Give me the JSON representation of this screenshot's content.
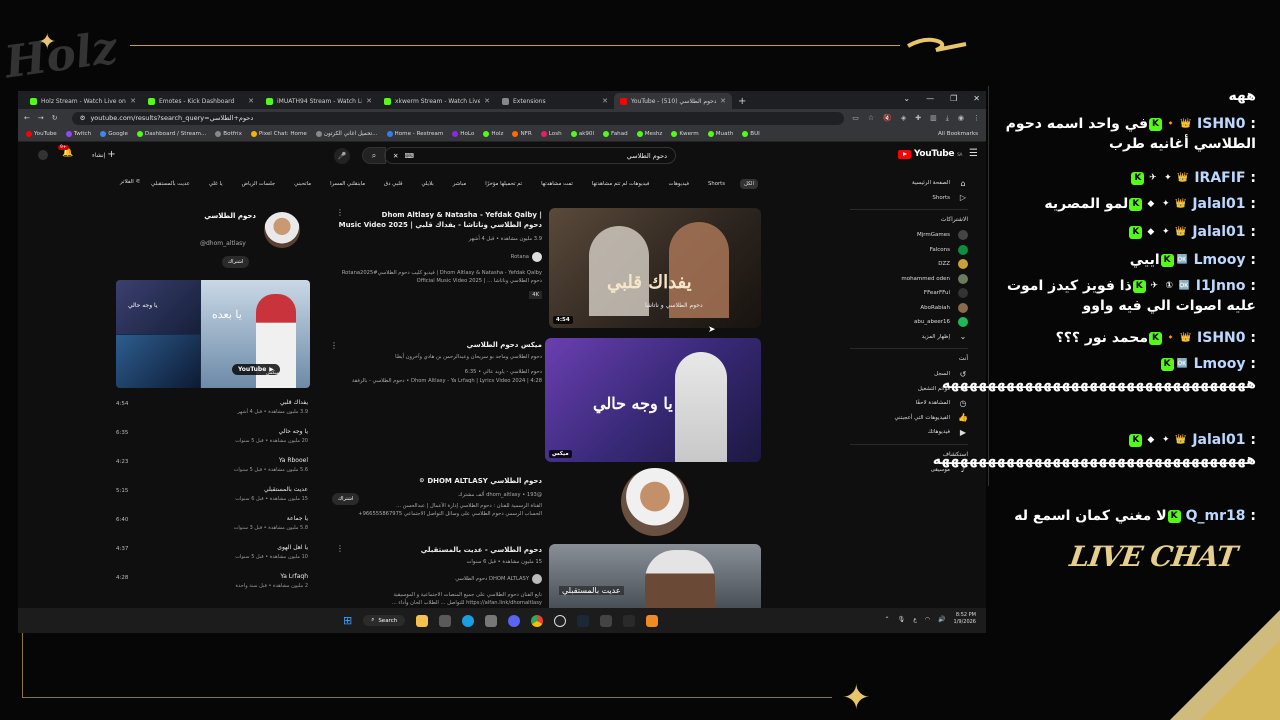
{
  "overlay": {
    "logo_text": "Holz",
    "live_chat_label": "LIVE CHAT"
  },
  "browser": {
    "tabs": [
      {
        "label": "Holz Stream - Watch Live on Ki",
        "color": "#53fc18",
        "active": false
      },
      {
        "label": "Emotes - Kick Dashboard",
        "color": "#53fc18",
        "active": false
      },
      {
        "label": "iMUATH94 Stream - Watch Live",
        "color": "#53fc18",
        "active": false
      },
      {
        "label": "xkwerm Stream - Watch Live on",
        "color": "#53fc18",
        "active": false
      },
      {
        "label": "Extensions",
        "color": "#888888",
        "active": false
      },
      {
        "label": "YouTube - دحوم الطلاسي (510)",
        "color": "#ff0000",
        "active": true
      }
    ],
    "url": "youtube.com/results?search_query=دحوم+الطلاسي",
    "all_bookmarks": "All Bookmarks",
    "bookmarks": [
      {
        "label": "YouTube",
        "color": "#ff0000"
      },
      {
        "label": "Twitch",
        "color": "#9146ff"
      },
      {
        "label": "Google",
        "color": "#4285f4"
      },
      {
        "label": "Dashboard / Stream...",
        "color": "#53fc18"
      },
      {
        "label": "Botfrix",
        "color": "#888888"
      },
      {
        "label": "Pixel Chat: Home",
        "color": "#f5b400"
      },
      {
        "label": "تحميل اغاني الكرتون...",
        "color": "#888888"
      },
      {
        "label": "Home - Restream",
        "color": "#2f80ed"
      },
      {
        "label": "HoLo",
        "color": "#8a2be2"
      },
      {
        "label": "Holz",
        "color": "#53fc18"
      },
      {
        "label": "NFR",
        "color": "#ff6b00"
      },
      {
        "label": "Losh",
        "color": "#e91e63"
      },
      {
        "label": "ak90l",
        "color": "#53fc18"
      },
      {
        "label": "Fahad",
        "color": "#53fc18"
      },
      {
        "label": "Meshz",
        "color": "#53fc18"
      },
      {
        "label": "Kwerm",
        "color": "#53fc18"
      },
      {
        "label": "Muath",
        "color": "#53fc18"
      },
      {
        "label": "BUI",
        "color": "#53fc18"
      }
    ]
  },
  "youtube": {
    "logo": "YouTube",
    "logo_region": "SA",
    "search_query": "دحوم الطلاسي",
    "create_label": "إنشاء",
    "notification_count": "9+",
    "filter_label": "الفلاتر",
    "chips": [
      "الكل",
      "Shorts",
      "فيديوهات",
      "فيديوهات لم تتم مشاهدتها",
      "تمت مشاهدتها",
      "تم تحميلها مؤخرًا",
      "مباشر",
      "بلايلي",
      "قلبي دق",
      "ماينقلني المسرا",
      "ماتحبني",
      "جلسات الرياض",
      "يا غلي",
      "عديت بالمستقبلي"
    ],
    "sidebar": {
      "home": "الصفحة الرئيسية",
      "shorts": "Shorts",
      "subscriptions_head": "الاشتراكات",
      "subscriptions": [
        {
          "name": "MjrmGames",
          "color": "#444444"
        },
        {
          "name": "Falcons",
          "color": "#0a8f3c"
        },
        {
          "name": "DZZ",
          "color": "#c9a03a"
        },
        {
          "name": "mohammed oden",
          "color": "#6b7c5d"
        },
        {
          "name": "FFearFFul",
          "color": "#333333"
        },
        {
          "name": "AboRabiah",
          "color": "#8a6a4a"
        },
        {
          "name": "abu_abeer16",
          "color": "#1db954"
        }
      ],
      "show_more": "إظهار المزيد",
      "you_head": "أنت",
      "you_items": [
        "السجل",
        "قوائم التشغيل",
        "المشاهدة لاحقًا",
        "الفيديوهات التي أعجبتني",
        "فيديوهاتك"
      ],
      "explore_head": "استكشاف",
      "explore_items": [
        "موسيقى"
      ]
    },
    "results": [
      {
        "title_1": "Dhom Altlasy & Natasha - Yefdak Qalby |",
        "title_2": "دحوم الطلاسي وناتاشا - يفداك قلبي | Music Video 2025",
        "meta": "3.9 مليون مشاهدة • قبل 4 أشهر",
        "channel": "Rotana",
        "desc_1": "Dhom Altlasy & Natasha - Yefdak Qalby | فيديو كليب دحوم الطلاسي#Rotana2025",
        "desc_2": "دحوم الطلاسي وناتاشا ... | Official Music Video 2025",
        "badge": "4K",
        "duration": "4:54",
        "thumb_text": "يفداك قلبي",
        "thumb_sub": "دحوم الطلاسي و ناتاشا"
      },
      {
        "title_1": "ميكس دحوم الطلاسي",
        "meta": "دحوم الطلاسي وماجد بو سريحان وعبدالرحمن بن هادي وآخرون أيضًا",
        "line_1": "دحوم الطلاسي - ياويد عالي • 6:35",
        "line_2": "Dhom Altlasy - Ya Lrfaqh | Lyrics Video 2024 | 4:28 • دحوم الطلاسي - بالرفقة",
        "duration": "ميكس",
        "thumb_text": "يا وجه حالي"
      },
      {
        "channel_name": "دحوم الطلاسي DHOM ALTLASY",
        "handle": "@dhom_altlasy • 193 ألف مشترك",
        "desc_1": "القناة الرسمية للفنان : دحوم الطلاسي إدارة الأعمال | عبدالحسن ...",
        "desc_2": "الحساب الرسمي دحوم الطلاسي على وسائل التواصل الاجتماعي 966555867975+",
        "subscribe": "اشتراك"
      },
      {
        "title_1": "دحوم الطلاسي - عديت بالمستقبلي",
        "meta": "15 مليون مشاهدة • قبل 6 سنوات",
        "channel": "DHOM ALTLASY دحوم الطلاسي",
        "desc_1": "تابع الفنان دحوم الطلاسي على جميع المنصات الاجتماعية و الموسيقية",
        "desc_2": "https://alfan.link/dhomaltlasy للتواصل ... الطلاب الحان وأداء ...",
        "thumb_text": "عديت بالمستقبلي"
      }
    ],
    "channel_panel": {
      "name": "دحوم الطلاسي",
      "handle": "@dhom_altlasy",
      "subscribe": "اشتراك",
      "mix_label": "ميكس",
      "yt_badge": "YouTube",
      "thumb_main": "يا بعده",
      "thumb_2": "يا وجه حالي",
      "rows": [
        {
          "dur": "4:54",
          "title": "يفداك قلبي",
          "meta": "3.9 مليون مشاهدة • قبل 4 أشهر"
        },
        {
          "dur": "6:35",
          "title": "يا وجه حالي",
          "meta": "20 مليون مشاهدة • قبل 5 سنوات"
        },
        {
          "dur": "4:23",
          "title": "Ya Rbooel",
          "meta": "5.6 مليون مشاهدة • قبل 5 سنوات"
        },
        {
          "dur": "5:15",
          "title": "عديت بالمستقبلي",
          "meta": "15 مليون مشاهدة • قبل 6 سنوات"
        },
        {
          "dur": "6:40",
          "title": "يا جماعة",
          "meta": "5.8 مليون مشاهدة • قبل 3 سنوات"
        },
        {
          "dur": "4:37",
          "title": "يا اهل الهوى",
          "meta": "10 مليون مشاهدة • قبل 5 سنوات"
        },
        {
          "dur": "4:28",
          "title": "Ya Lrfaqh",
          "meta": "2 مليون مشاهدة • قبل سنة واحدة"
        }
      ]
    }
  },
  "taskbar": {
    "search": "Search",
    "time": "8:52 PM",
    "date": "1/9/2026",
    "lang": "ع"
  },
  "chat": {
    "messages": [
      {
        "user": "",
        "text": "ههه",
        "badges": []
      },
      {
        "user": "ISHN0",
        "text": "في واحد اسمه دحوم الطلاسي أغانيه طرب",
        "badges": [
          "k",
          "flame",
          "crown"
        ]
      },
      {
        "user": "IRAFIF",
        "text": "",
        "badges": [
          "k",
          "ice",
          "star",
          "crown"
        ]
      },
      {
        "user": "Jalal01",
        "text": "لمو المصريه",
        "badges": [
          "k",
          "cube",
          "star",
          "crown"
        ]
      },
      {
        "user": "Jalal01",
        "text": "",
        "badges": [
          "k",
          "cube",
          "star",
          "crown"
        ]
      },
      {
        "user": "Lmooy",
        "text": "اييي",
        "badges": [
          "k",
          "mod"
        ]
      },
      {
        "user": "I1Jnno",
        "text": "ذا فويز كيدز اموت عليه اصوات الي فيه واوو",
        "badges": [
          "k",
          "ice",
          "one",
          "mod"
        ]
      },
      {
        "user": "ISHN0",
        "text": "محمد نور ؟؟؟",
        "badges": [
          "k",
          "flame",
          "crown"
        ]
      },
      {
        "user": "Lmooy",
        "text": "هههههههههههههههههههههههههههههههههه",
        "badges": [
          "k",
          "mod"
        ]
      },
      {
        "user": "Jalal01",
        "text": "ههههههههههههههههههههههههههههههههههه",
        "badges": [
          "k",
          "cube",
          "star",
          "crown"
        ]
      },
      {
        "user": "Q_mr18",
        "text": "لا مغني كمان اسمع له",
        "badges": [
          "k"
        ]
      }
    ]
  }
}
